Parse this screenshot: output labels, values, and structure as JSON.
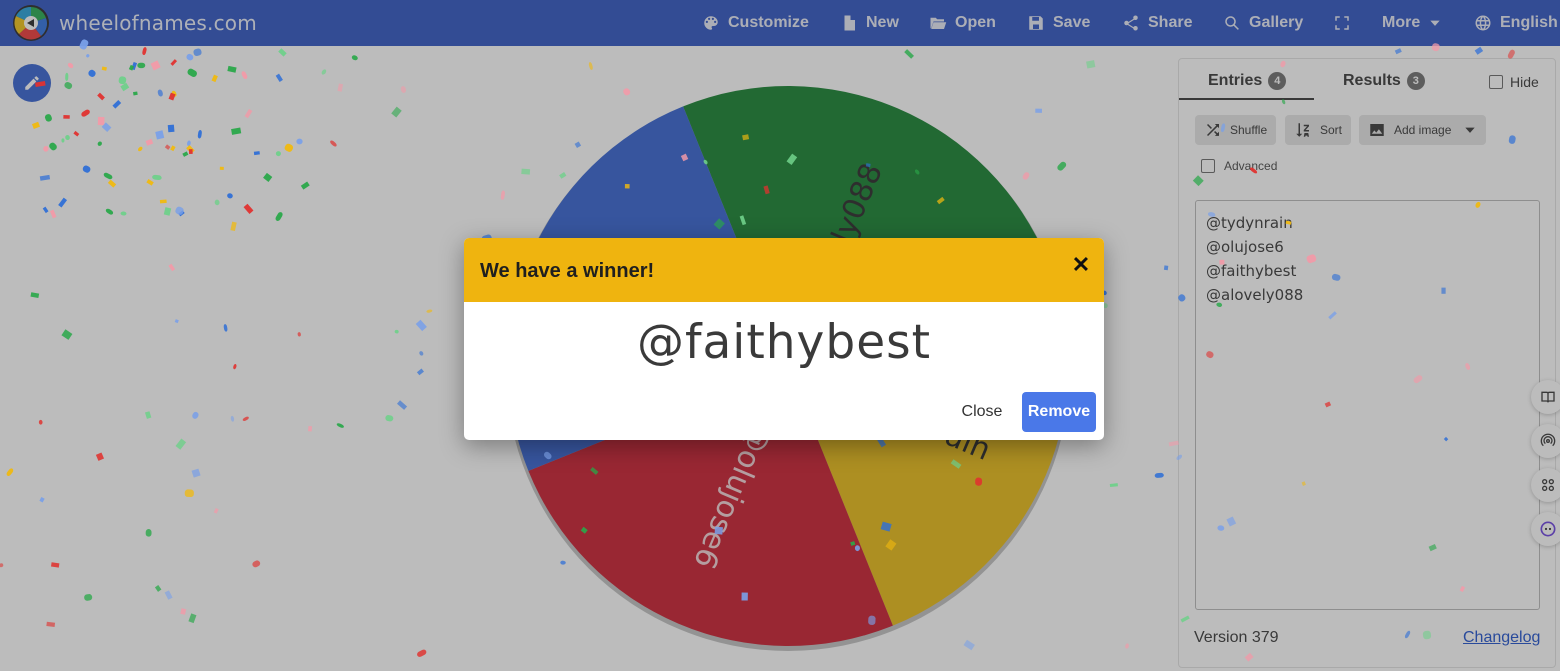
{
  "app": {
    "site_title": "wheelofnames.com"
  },
  "nav": {
    "customize": "Customize",
    "new": "New",
    "open": "Open",
    "save": "Save",
    "share": "Share",
    "gallery": "Gallery",
    "more": "More",
    "language": "English"
  },
  "wheel": {
    "segments": [
      {
        "label": "@alovely088",
        "color": "#0f7d2a"
      },
      {
        "label": "@tydynrain",
        "color": "#e8b90f"
      },
      {
        "label": "@olujose6",
        "color": "#c8162a"
      },
      {
        "label": "@faithybest",
        "color": "#2f5fd0"
      }
    ]
  },
  "panel": {
    "tabs": {
      "entries_label": "Entries",
      "entries_count": "4",
      "results_label": "Results",
      "results_count": "3"
    },
    "hide_label": "Hide",
    "toolbar": {
      "shuffle": "Shuffle",
      "sort": "Sort",
      "add_image": "Add image"
    },
    "advanced_label": "Advanced",
    "entries": [
      "@tydynrain",
      "@olujose6",
      "@faithybest",
      "@alovely088"
    ],
    "version": "Version 379",
    "changelog": "Changelog"
  },
  "dialog": {
    "title": "We have a winner!",
    "winner": "@faithybest",
    "close_label": "Close",
    "remove_label": "Remove"
  },
  "colors": {
    "topbar": "#2a50c0",
    "dialog_header": "#efb40f",
    "remove_button": "#4a78e8"
  }
}
